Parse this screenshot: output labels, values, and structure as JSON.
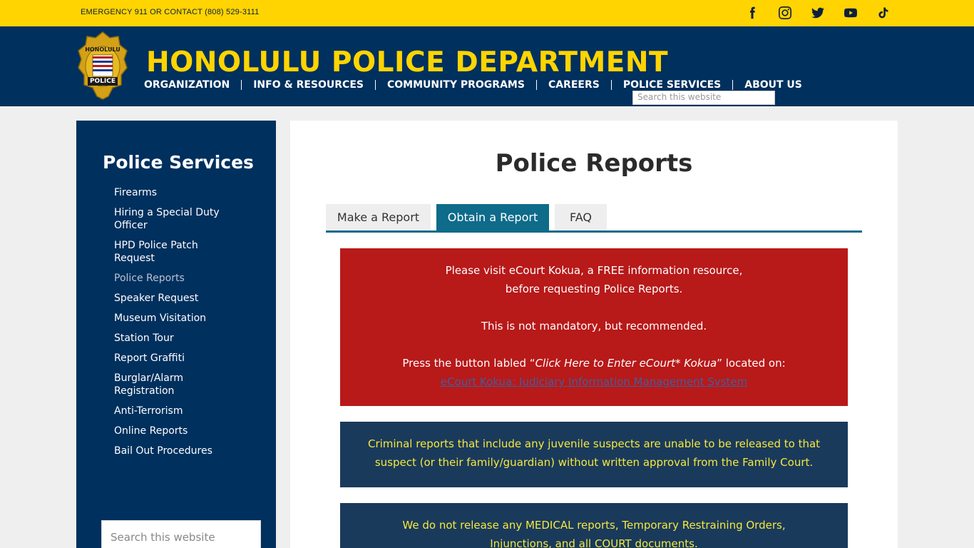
{
  "topbar": {
    "emergency": "EMERGENCY  911 OR CONTACT (808) 529-3111",
    "social_icons": [
      "facebook-icon",
      "instagram-icon",
      "twitter-icon",
      "youtube-icon",
      "tiktok-icon"
    ]
  },
  "header": {
    "title": "HONOLULU POLICE DEPARTMENT",
    "logo_text_top": "HONOLULU",
    "logo_text_bottom": "POLICE",
    "nav": [
      "ORGANIZATION",
      "INFO & RESOURCES",
      "COMMUNITY PROGRAMS",
      "CAREERS",
      "POLICE SERVICES",
      "ABOUT US"
    ],
    "search_placeholder": "Search this website"
  },
  "sidebar": {
    "title": "Police Services",
    "items": [
      {
        "label": "Firearms"
      },
      {
        "label": "Hiring a Special Duty Officer"
      },
      {
        "label": "HPD Police Patch Request"
      },
      {
        "label": "Police Reports"
      },
      {
        "label": "Speaker Request"
      },
      {
        "label": "Museum Visitation"
      },
      {
        "label": "Station Tour"
      },
      {
        "label": "Report Graffiti"
      },
      {
        "label": "Burglar/Alarm Registration"
      },
      {
        "label": "Anti-Terrorism"
      },
      {
        "label": "Online Reports"
      },
      {
        "label": "Bail Out Procedures"
      }
    ],
    "search_placeholder": "Search this website"
  },
  "main": {
    "title": "Police Reports",
    "tabs": [
      {
        "label": "Make a Report"
      },
      {
        "label": "Obtain a Report"
      },
      {
        "label": "FAQ"
      }
    ],
    "notice": {
      "line1": "Please visit eCourt Kokua, a FREE information resource,",
      "line2": "before requesting Police Reports.",
      "line3": "This is not mandatory, but recommended.",
      "line4_pre": "Press the button labled “",
      "line4_em": "Click Here to Enter eCourt* Kokua",
      "line4_post": "” located on:",
      "link": "eCourt Kokua: Judiciary Information Management System"
    },
    "juvenile": {
      "line1": "Criminal reports that include any juvenile suspects are unable to be released to that",
      "line2": "suspect (or their family/guardian) without written approval from the Family Court."
    },
    "medical": {
      "line1": "We do not release any MEDICAL reports, Temporary Restraining Orders,",
      "line2": "Injunctions, and all COURT documents."
    }
  },
  "colors": {
    "yellow": "#ffd400",
    "navy": "#00305e",
    "teal": "#0e6b8a",
    "red": "#b81919"
  }
}
